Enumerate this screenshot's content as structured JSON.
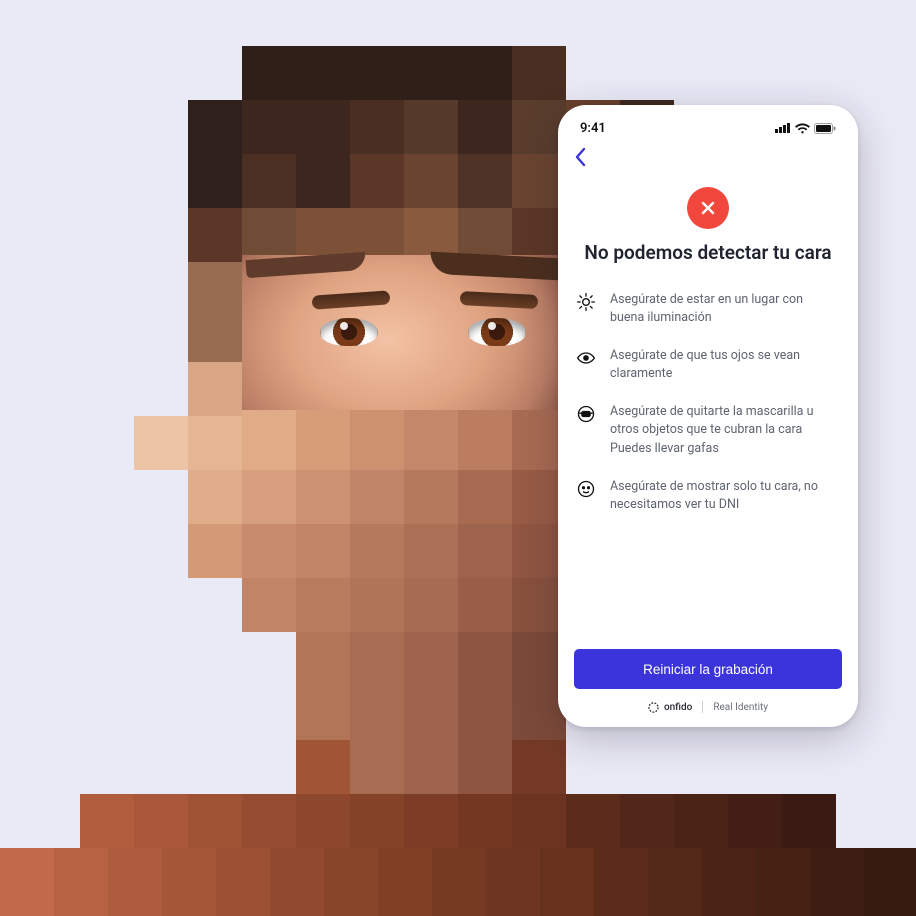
{
  "status_bar": {
    "time": "9:41"
  },
  "screen": {
    "title": "No podemos detectar tu cara",
    "tips": [
      {
        "icon": "sun-icon",
        "text": "Asegúrate de estar en un lugar con buena iluminación"
      },
      {
        "icon": "eye-icon",
        "text": "Asegúrate de que tus ojos se vean claramente"
      },
      {
        "icon": "mask-icon",
        "text": "Asegúrate de quitarte la mascarilla u otros objetos que te cubran la cara Puedes llevar gafas"
      },
      {
        "icon": "face-icon",
        "text": "Asegúrate de mostrar solo tu cara, no necesitamos ver tu DNI"
      }
    ],
    "cta_label": "Reiniciar la grabación",
    "footer_brand": "onfido",
    "footer_tag": "Real Identity"
  }
}
